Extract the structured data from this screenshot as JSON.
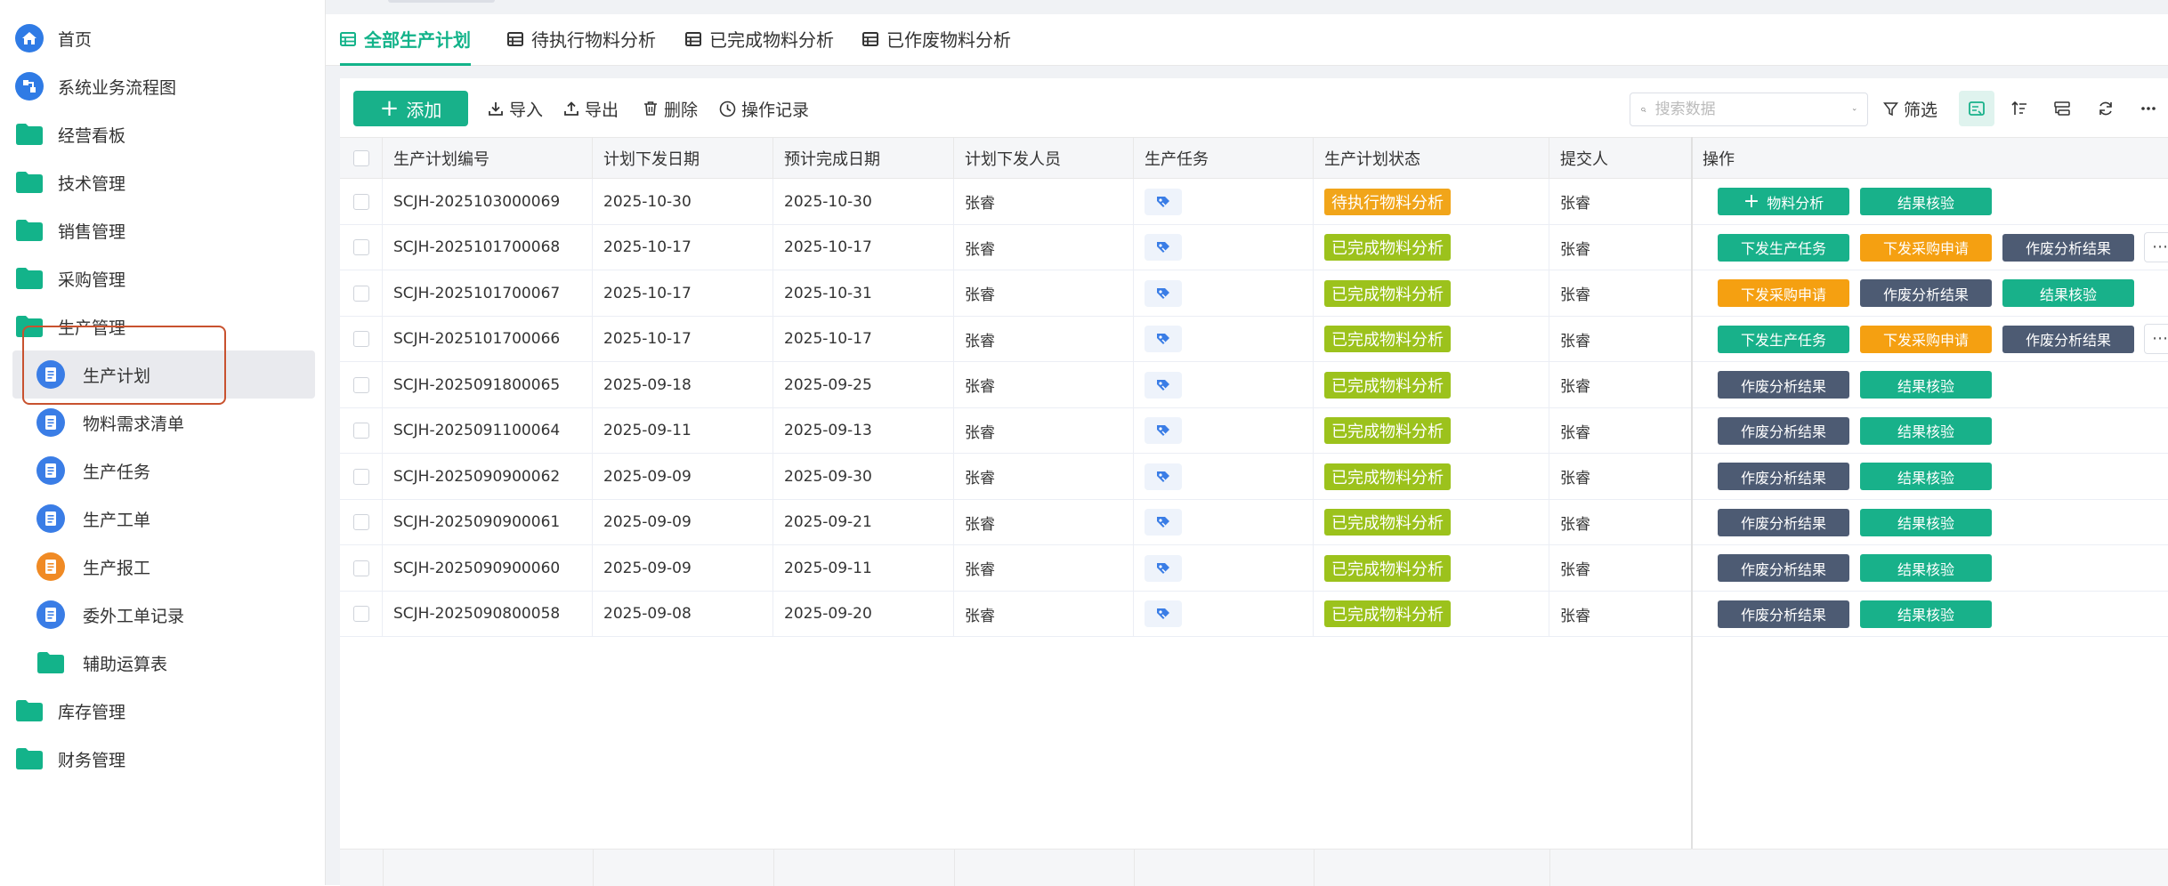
{
  "sidebar": {
    "items": [
      {
        "label": "首页",
        "icon": "home-icon"
      },
      {
        "label": "系统业务流程图",
        "icon": "flow-icon"
      },
      {
        "label": "经营看板",
        "icon": "folder-icon"
      },
      {
        "label": "技术管理",
        "icon": "folder-icon"
      },
      {
        "label": "销售管理",
        "icon": "folder-icon"
      },
      {
        "label": "采购管理",
        "icon": "folder-icon"
      },
      {
        "label": "生产管理",
        "icon": "folder-open-icon"
      },
      {
        "label": "生产计划",
        "icon": "document-icon"
      },
      {
        "label": "物料需求清单",
        "icon": "document-icon"
      },
      {
        "label": "生产任务",
        "icon": "document-icon"
      },
      {
        "label": "生产工单",
        "icon": "document-icon"
      },
      {
        "label": "生产报工",
        "icon": "document-icon"
      },
      {
        "label": "委外工单记录",
        "icon": "document-icon"
      },
      {
        "label": "辅助运算表",
        "icon": "folder-icon"
      },
      {
        "label": "库存管理",
        "icon": "folder-icon"
      },
      {
        "label": "财务管理",
        "icon": "folder-icon"
      }
    ]
  },
  "tabs": [
    {
      "label": "全部生产计划"
    },
    {
      "label": "待执行物料分析"
    },
    {
      "label": "已完成物料分析"
    },
    {
      "label": "已作废物料分析"
    }
  ],
  "toolbar": {
    "add_label": "添加",
    "import_label": "导入",
    "export_label": "导出",
    "delete_label": "删除",
    "history_label": "操作记录",
    "search_placeholder": "搜索数据",
    "filter_label": "筛选"
  },
  "table": {
    "columns": [
      "生产计划编号",
      "计划下发日期",
      "预计完成日期",
      "计划下发人员",
      "生产任务",
      "生产计划状态",
      "提交人",
      "操作"
    ],
    "rows": [
      {
        "code": "SCJH-2025103000069",
        "issue_date": "2025-10-30",
        "due_date": "2025-10-30",
        "issuer": "张睿",
        "status": "待执行物料分析",
        "submitter": "张睿"
      },
      {
        "code": "SCJH-2025101700068",
        "issue_date": "2025-10-17",
        "due_date": "2025-10-17",
        "issuer": "张睿",
        "status": "已完成物料分析",
        "submitter": "张睿"
      },
      {
        "code": "SCJH-2025101700067",
        "issue_date": "2025-10-17",
        "due_date": "2025-10-31",
        "issuer": "张睿",
        "status": "已完成物料分析",
        "submitter": "张睿"
      },
      {
        "code": "SCJH-2025101700066",
        "issue_date": "2025-10-17",
        "due_date": "2025-10-17",
        "issuer": "张睿",
        "status": "已完成物料分析",
        "submitter": "张睿"
      },
      {
        "code": "SCJH-2025091800065",
        "issue_date": "2025-09-18",
        "due_date": "2025-09-25",
        "issuer": "张睿",
        "status": "已完成物料分析",
        "submitter": "张睿"
      },
      {
        "code": "SCJH-2025091100064",
        "issue_date": "2025-09-11",
        "due_date": "2025-09-13",
        "issuer": "张睿",
        "status": "已完成物料分析",
        "submitter": "张睿"
      },
      {
        "code": "SCJH-2025090900062",
        "issue_date": "2025-09-09",
        "due_date": "2025-09-30",
        "issuer": "张睿",
        "status": "已完成物料分析",
        "submitter": "张睿"
      },
      {
        "code": "SCJH-2025090900061",
        "issue_date": "2025-09-09",
        "due_date": "2025-09-21",
        "issuer": "张睿",
        "status": "已完成物料分析",
        "submitter": "张睿"
      },
      {
        "code": "SCJH-2025090900060",
        "issue_date": "2025-09-09",
        "due_date": "2025-09-11",
        "issuer": "张睿",
        "status": "已完成物料分析",
        "submitter": "张睿"
      },
      {
        "code": "SCJH-2025090800058",
        "issue_date": "2025-09-08",
        "due_date": "2025-09-20",
        "issuer": "张睿",
        "status": "已完成物料分析",
        "submitter": "张睿"
      }
    ]
  },
  "actions": {
    "material_analysis": "物料分析",
    "result_verify": "结果核验",
    "issue_task": "下发生产任务",
    "issue_purchase": "下发采购申请",
    "void_result": "作废分析结果"
  },
  "colors": {
    "primary": "#18b18a",
    "pending": "#f1a51a",
    "done": "#9cc21c",
    "orange": "#f5a011",
    "slate": "#4d5b73",
    "highlight": "#c8522f"
  }
}
